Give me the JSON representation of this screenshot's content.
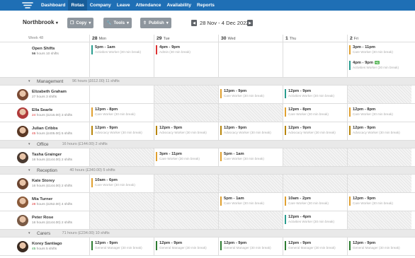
{
  "nav": {
    "items": [
      "Dashboard",
      "Rotas",
      "Company",
      "Leave",
      "Attendance",
      "Availability",
      "Reports"
    ],
    "active": 1
  },
  "toolbar": {
    "location": "Northbrook",
    "copy": "Copy",
    "tools": "Tools",
    "publish": "Publish",
    "date_range": "28 Nov - 4 Dec 2022"
  },
  "header": {
    "week": "Week 48",
    "days": [
      {
        "num": "28",
        "name": "Mon"
      },
      {
        "num": "29",
        "name": "Tue"
      },
      {
        "num": "30",
        "name": "Wed"
      },
      {
        "num": "1",
        "name": "Thu"
      },
      {
        "num": "2",
        "name": "Fri"
      }
    ]
  },
  "open_shifts": {
    "name": "Open Shifts",
    "hours": "56",
    "hours_label": "hours",
    "shifts": "10 shifts",
    "cells": [
      [
        {
          "time": "5pm - 1am",
          "role": "Activities Worker (30 min break)"
        }
      ],
      [
        {
          "time": "4pm - 9pm",
          "role": "Admin (30 min break)"
        }
      ],
      [],
      [],
      [
        {
          "time": "3pm - 11pm",
          "role": "Care Worker (30 min break)"
        },
        {
          "time": "4pm - 9pm",
          "role": "Activities Worker (30 min break)",
          "badge": "+1"
        }
      ]
    ]
  },
  "groups": [
    {
      "name": "Management",
      "info": "96 hours (£612.00)",
      "shifts": "11 shifts",
      "people": [
        {
          "name": "Elizabeth Graham",
          "hours": "27",
          "hl": "hours",
          "shifts": "3 shifts",
          "color": "",
          "avatar": "#7a4a33",
          "cells": [
            [],
            [],
            [
              "12pm - 9pm",
              "Care Worker (30 min break)"
            ],
            [
              "12pm - 9pm",
              "Activities Worker (30 min break)"
            ],
            []
          ],
          "na": [
            1,
            4
          ]
        },
        {
          "name": "Ella Searle",
          "hours": "24",
          "hl": "hours (£216.00)",
          "shifts": "3 shifts",
          "color": "red",
          "avatar": "#b03a3a",
          "cells": [
            [
              "12pm - 8pm",
              "Care Worker (30 min break)"
            ],
            [],
            [],
            [
              "12pm - 8pm",
              "Care Worker (30 min break)"
            ],
            [
              "12pm - 8pm",
              "Care Worker (30 min break)"
            ]
          ],
          "na": [
            1,
            2
          ]
        },
        {
          "name": "Julian Cribbs",
          "hours": "45",
          "hl": "hours (£405.00)",
          "shifts": "5 shifts",
          "color": "red",
          "avatar": "#5a3825",
          "cells": [
            [
              "12pm - 9pm",
              "Advocacy Worker (30 min break)"
            ],
            [
              "12pm - 9pm",
              "Advocacy Worker (30 min break)"
            ],
            [
              "12pm - 9pm",
              "Advocacy Worker (30 min break)"
            ],
            [
              "12pm - 9pm",
              "Advocacy Worker (30 min break)"
            ],
            [
              "12pm - 9pm",
              "Advocacy Worker (30 min break)"
            ]
          ],
          "na": []
        }
      ]
    },
    {
      "name": "Office",
      "info": "16 hours (£144.00)",
      "shifts": "2 shifts",
      "people": [
        {
          "name": "Tasha Grainger",
          "hours": "16",
          "hl": "hours (£144.00)",
          "shifts": "2 shifts",
          "color": "",
          "avatar": "#4a3a30",
          "cells": [
            [],
            [
              "3pm - 11pm",
              "Care Worker (30 min break)"
            ],
            [
              "5pm - 1am",
              "Care Worker (30 min break)"
            ],
            [],
            []
          ],
          "na": [
            0,
            3,
            4
          ]
        }
      ]
    },
    {
      "name": "Reception",
      "info": "40 hours (£340.00)",
      "shifts": "5 shifts",
      "people": [
        {
          "name": "Kate Storey",
          "hours": "16",
          "hl": "hours (£144.00)",
          "shifts": "2 shifts",
          "color": "",
          "avatar": "#6b4530",
          "cells": [
            [
              "10am - 6pm",
              "Care Worker (30 min break)"
            ],
            [],
            [],
            [],
            []
          ],
          "na": [
            1,
            2,
            3,
            4
          ]
        },
        {
          "name": "Mia Turner",
          "hours": "28",
          "hl": "hours (£252.00)",
          "shifts": "4 shifts",
          "color": "red",
          "avatar": "#8a5a3a",
          "cells": [
            [],
            [],
            [
              "5pm - 1am",
              "Care Worker (30 min break)"
            ],
            [
              "10am - 2pm",
              "Care Worker (30 min break)"
            ],
            [
              "12pm - 9pm",
              "Care Worker (30 min break)"
            ]
          ],
          "na": [
            0,
            1
          ]
        },
        {
          "name": "Peter Rose",
          "hours": "16",
          "hl": "hours (£144.00)",
          "shifts": "2 shifts",
          "color": "",
          "avatar": "#7a5a45",
          "cells": [
            [],
            [],
            [],
            [
              "12pm - 4pm",
              "Activities Worker (30 min break)"
            ],
            []
          ],
          "na": [
            0,
            1,
            2,
            4
          ]
        }
      ]
    },
    {
      "name": "Carers",
      "info": "71 hours (£234.00)",
      "shifts": "10 shifts",
      "people": [
        {
          "name": "Korey Santiago",
          "hours": "45",
          "hl": "hours",
          "shifts": "5 shifts",
          "color": "grn",
          "avatar": "#3a2a20",
          "cells": [
            [
              "12pm - 9pm",
              "General Manager (30 min break)"
            ],
            [
              "12pm - 9pm",
              "General Manager (30 min break)"
            ],
            [
              "12pm - 9pm",
              "General Manager (30 min break)"
            ],
            [
              "12pm - 9pm",
              "General Manager (30 min break)"
            ],
            [
              "12pm - 9pm",
              "General Manager (30 min break)"
            ]
          ],
          "na": []
        }
      ]
    }
  ],
  "colors": {
    "nav": "#1f6fb5",
    "open": "#2a9d8f",
    "mgmt": "#2a9d8f",
    "amber": "#e0a030",
    "red": "#d33"
  }
}
